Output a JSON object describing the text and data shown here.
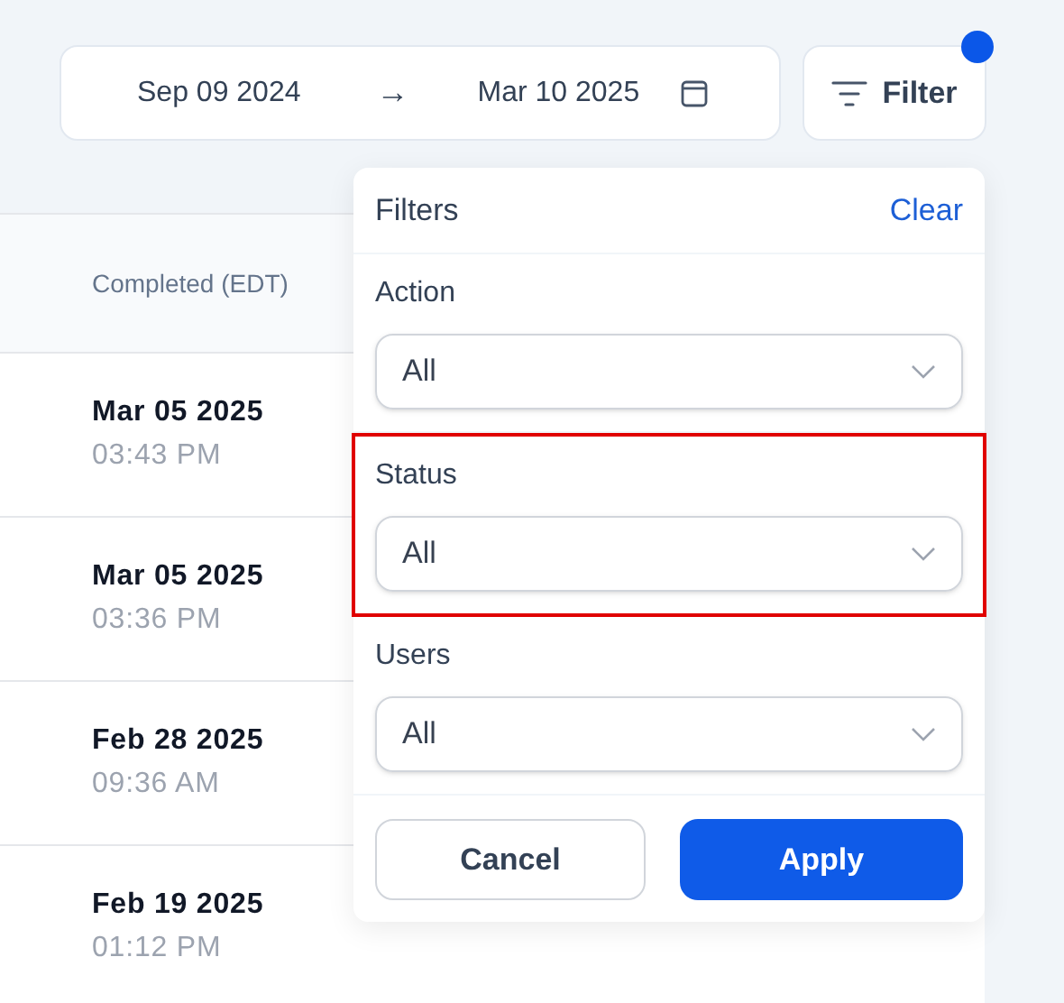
{
  "date_range": {
    "start": "Sep 09 2024",
    "arrow": "→",
    "end": "Mar 10 2025"
  },
  "filter_button": {
    "label": "Filter",
    "has_active_dot": true
  },
  "table": {
    "columns": [
      "Completed (EDT)"
    ],
    "rows": [
      {
        "date": "Mar 05 2025",
        "time": "03:43 PM"
      },
      {
        "date": "Mar 05 2025",
        "time": "03:36 PM"
      },
      {
        "date": "Feb 28 2025",
        "time": "09:36 AM"
      },
      {
        "date": "Feb 19 2025",
        "time": "01:12 PM"
      }
    ]
  },
  "filters_popup": {
    "title": "Filters",
    "clear": "Clear",
    "sections": [
      {
        "label": "Action",
        "value": "All",
        "highlighted": false
      },
      {
        "label": "Status",
        "value": "All",
        "highlighted": true
      },
      {
        "label": "Users",
        "value": "All",
        "highlighted": false
      }
    ],
    "buttons": [
      {
        "label": "Cancel",
        "kind": "secondary"
      },
      {
        "label": "Apply",
        "kind": "primary"
      }
    ]
  }
}
